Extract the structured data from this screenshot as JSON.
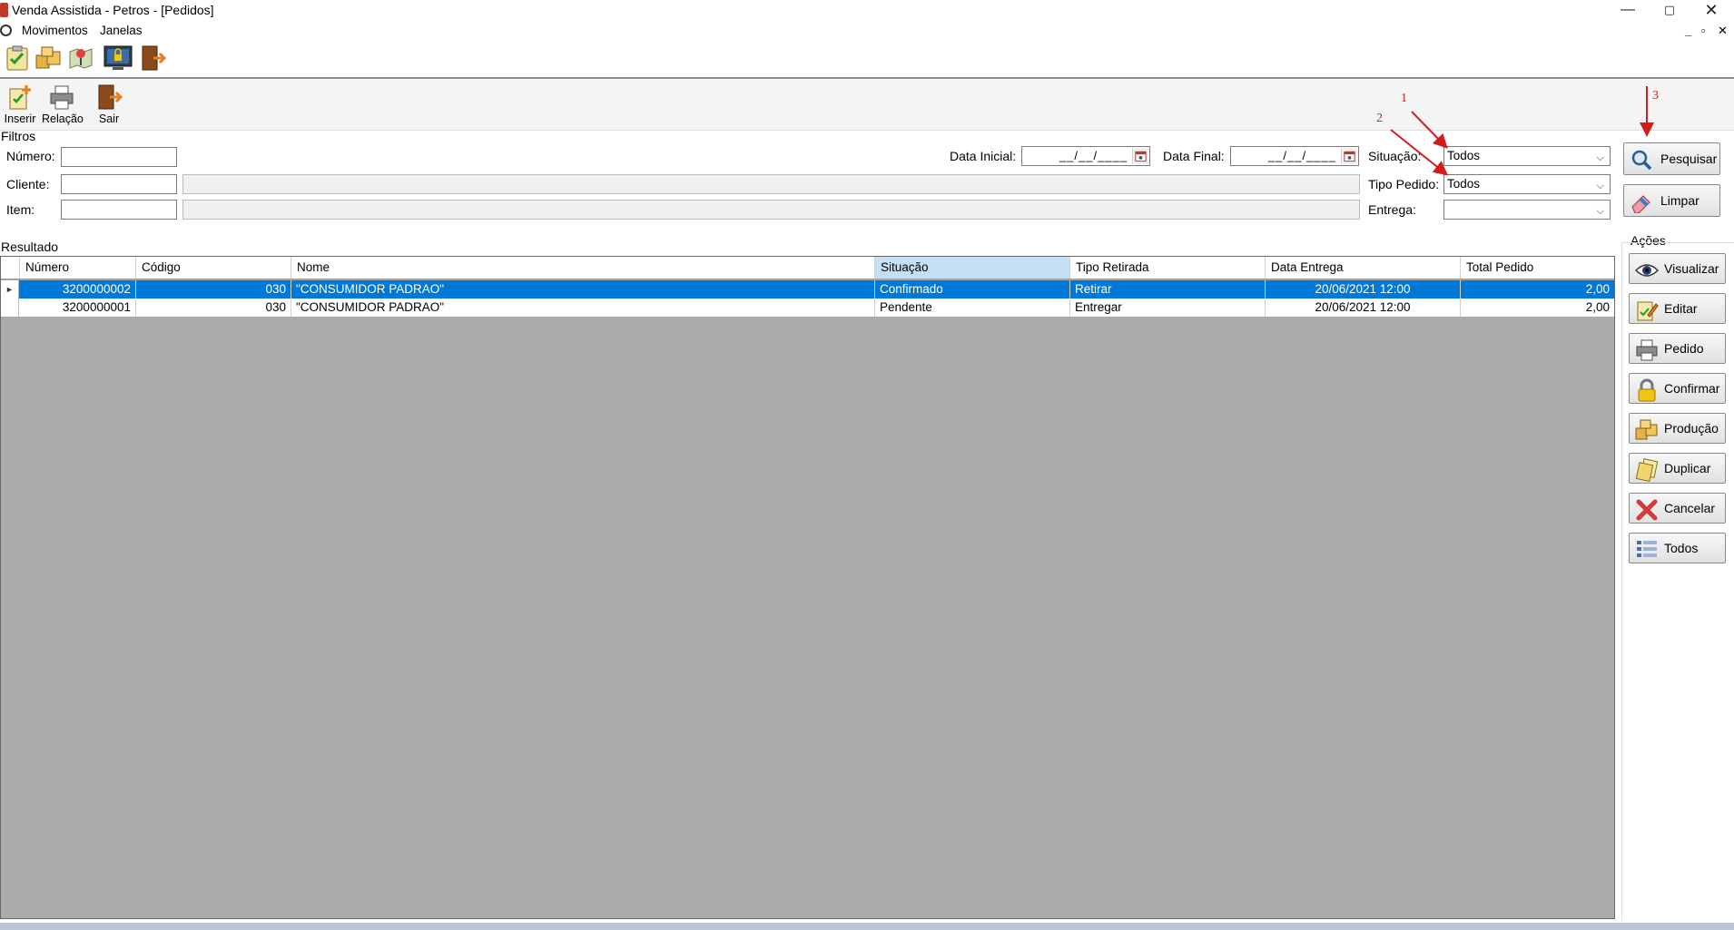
{
  "window": {
    "title": "Venda Assistida - Petros - [Pedidos]",
    "controls": {
      "minimize": "—",
      "maximize": "▢",
      "close": "✕"
    }
  },
  "menu": {
    "items": [
      {
        "label": "Movimentos"
      },
      {
        "label": "Janelas"
      }
    ],
    "mdi_controls": {
      "minimize": "_",
      "restore": "▫",
      "close": "✕"
    }
  },
  "top_toolbar": {
    "icons": [
      "checklist-icon",
      "boxes-icon",
      "map-icon",
      "monitor-lock-icon",
      "exit-door-icon"
    ]
  },
  "action_toolbar": {
    "buttons": [
      {
        "label": "Inserir",
        "icon": "insert-icon"
      },
      {
        "label": "Relação",
        "icon": "printer-icon"
      },
      {
        "label": "Sair",
        "icon": "exit-door-icon"
      }
    ]
  },
  "filters": {
    "group_label": "Filtros",
    "numero_label": "Número:",
    "numero_value": "",
    "cliente_label": "Cliente:",
    "cliente_value": "",
    "item_label": "Item:",
    "item_value": "",
    "data_inicial_label": "Data Inicial:",
    "data_inicial_value": "__/__/____",
    "data_final_label": "Data Final:",
    "data_final_value": "__/__/____",
    "situacao_label": "Situação:",
    "situacao_value": "Todos",
    "tipo_pedido_label": "Tipo Pedido:",
    "tipo_pedido_value": "Todos",
    "entrega_label": "Entrega:",
    "entrega_value": "",
    "pesquisar_label": "Pesquisar",
    "limpar_label": "Limpar"
  },
  "result": {
    "group_label": "Resultado",
    "columns": [
      "Número",
      "Código",
      "Nome",
      "Situação",
      "Tipo Retirada",
      "Data Entrega",
      "Total Pedido"
    ],
    "rows": [
      {
        "numero": "3200000002",
        "codigo": "030",
        "nome": "\"CONSUMIDOR PADRAO\"",
        "situacao": "Confirmado",
        "tipo_retirada": "Retirar",
        "data_entrega": "20/06/2021 12:00",
        "total": "2,00",
        "selected": true
      },
      {
        "numero": "3200000001",
        "codigo": "030",
        "nome": "\"CONSUMIDOR PADRAO\"",
        "situacao": "Pendente",
        "tipo_retirada": "Entregar",
        "data_entrega": "20/06/2021 12:00",
        "total": "2,00",
        "selected": false
      }
    ],
    "selection_color": "#0078d7",
    "sorted_column_color": "#c5dff5"
  },
  "actions": {
    "group_label": "Ações",
    "buttons": [
      {
        "label": "Visualizar",
        "icon": "eye-icon"
      },
      {
        "label": "Editar",
        "icon": "edit-icon"
      },
      {
        "label": "Pedido",
        "icon": "printer-icon"
      },
      {
        "label": "Confirmar",
        "icon": "lock-icon"
      },
      {
        "label": "Produção",
        "icon": "boxes-icon"
      },
      {
        "label": "Duplicar",
        "icon": "duplicate-icon"
      },
      {
        "label": "Cancelar",
        "icon": "cancel-x-icon"
      },
      {
        "label": "Todos",
        "icon": "list-icon"
      }
    ]
  },
  "annotations": {
    "markers": [
      "1",
      "2",
      "3"
    ],
    "color": "#d41b1b"
  }
}
